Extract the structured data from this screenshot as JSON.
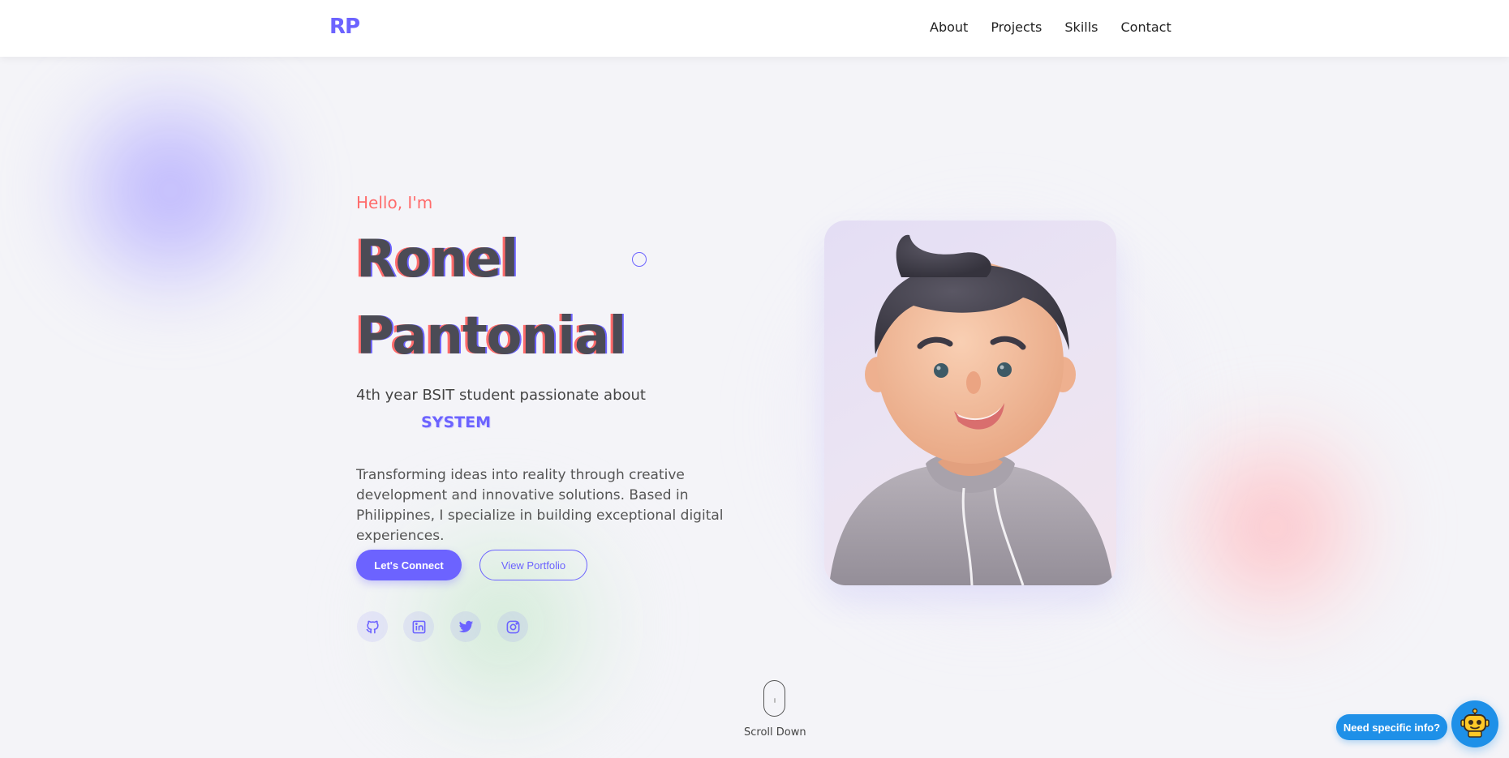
{
  "header": {
    "logo": "RP",
    "nav": [
      "About",
      "Projects",
      "Skills",
      "Contact"
    ]
  },
  "hero": {
    "greeting": "Hello, I'm",
    "name_line1": "Ronel",
    "name_line2": "Pantonial",
    "tagline": "4th year BSIT student passionate about",
    "typing_word": "SYSTEM",
    "intro": "Transforming ideas into reality through creative development and innovative solutions. Based in Philippines, I specialize in building exceptional digital experiences.",
    "primary_button": "Let's Connect",
    "secondary_button": "View Portfolio",
    "socials": [
      "github-icon",
      "linkedin-icon",
      "twitter-icon",
      "instagram-icon"
    ]
  },
  "scroll": {
    "label": "Scroll Down"
  },
  "chat": {
    "label": "Need specific info?"
  },
  "colors": {
    "accent": "#6c63ff",
    "greeting": "#ff6b6b",
    "chat": "#1e90e8"
  }
}
